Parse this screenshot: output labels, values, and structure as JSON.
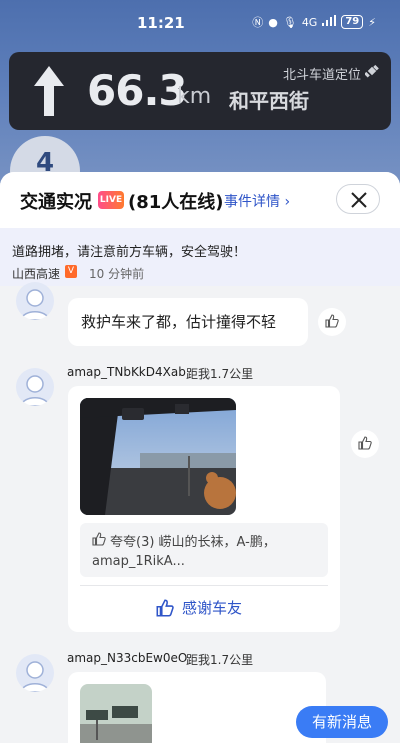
{
  "status_bar": {
    "time": "11:21",
    "network": "4G",
    "battery": "79"
  },
  "navigation": {
    "distance": "66.3",
    "unit": "km",
    "road": "和平西街",
    "positioning": "北斗车道定位",
    "lane": "4"
  },
  "panel": {
    "title": "交通实况",
    "live_badge": "LIVE",
    "online": "(81人在线)",
    "detail_link": "事件详情"
  },
  "notice": {
    "text": "道路拥堵，请注意前方车辆，安全驾驶！",
    "source": "山西高速",
    "time": "10 分钟前"
  },
  "comments": [
    {
      "text": "救护车来了都，估计撞得不轻"
    },
    {
      "username": "amap_TNbKkD4Xab",
      "distance": "距我1.7公里",
      "praise_line1": "夸夸(3) 崂山的长袜，A-鹏，",
      "praise_line2": "amap_1RikA...",
      "thanks": "感谢车友"
    },
    {
      "username": "amap_N33cbEw0eO",
      "distance": "距我1.7公里"
    }
  ],
  "new_message": "有新消息",
  "colors": {
    "accent": "#2f55c8",
    "live": "#ff4d8a",
    "new_message_bg": "#3a7cf5",
    "nav_card": "#25272f"
  }
}
